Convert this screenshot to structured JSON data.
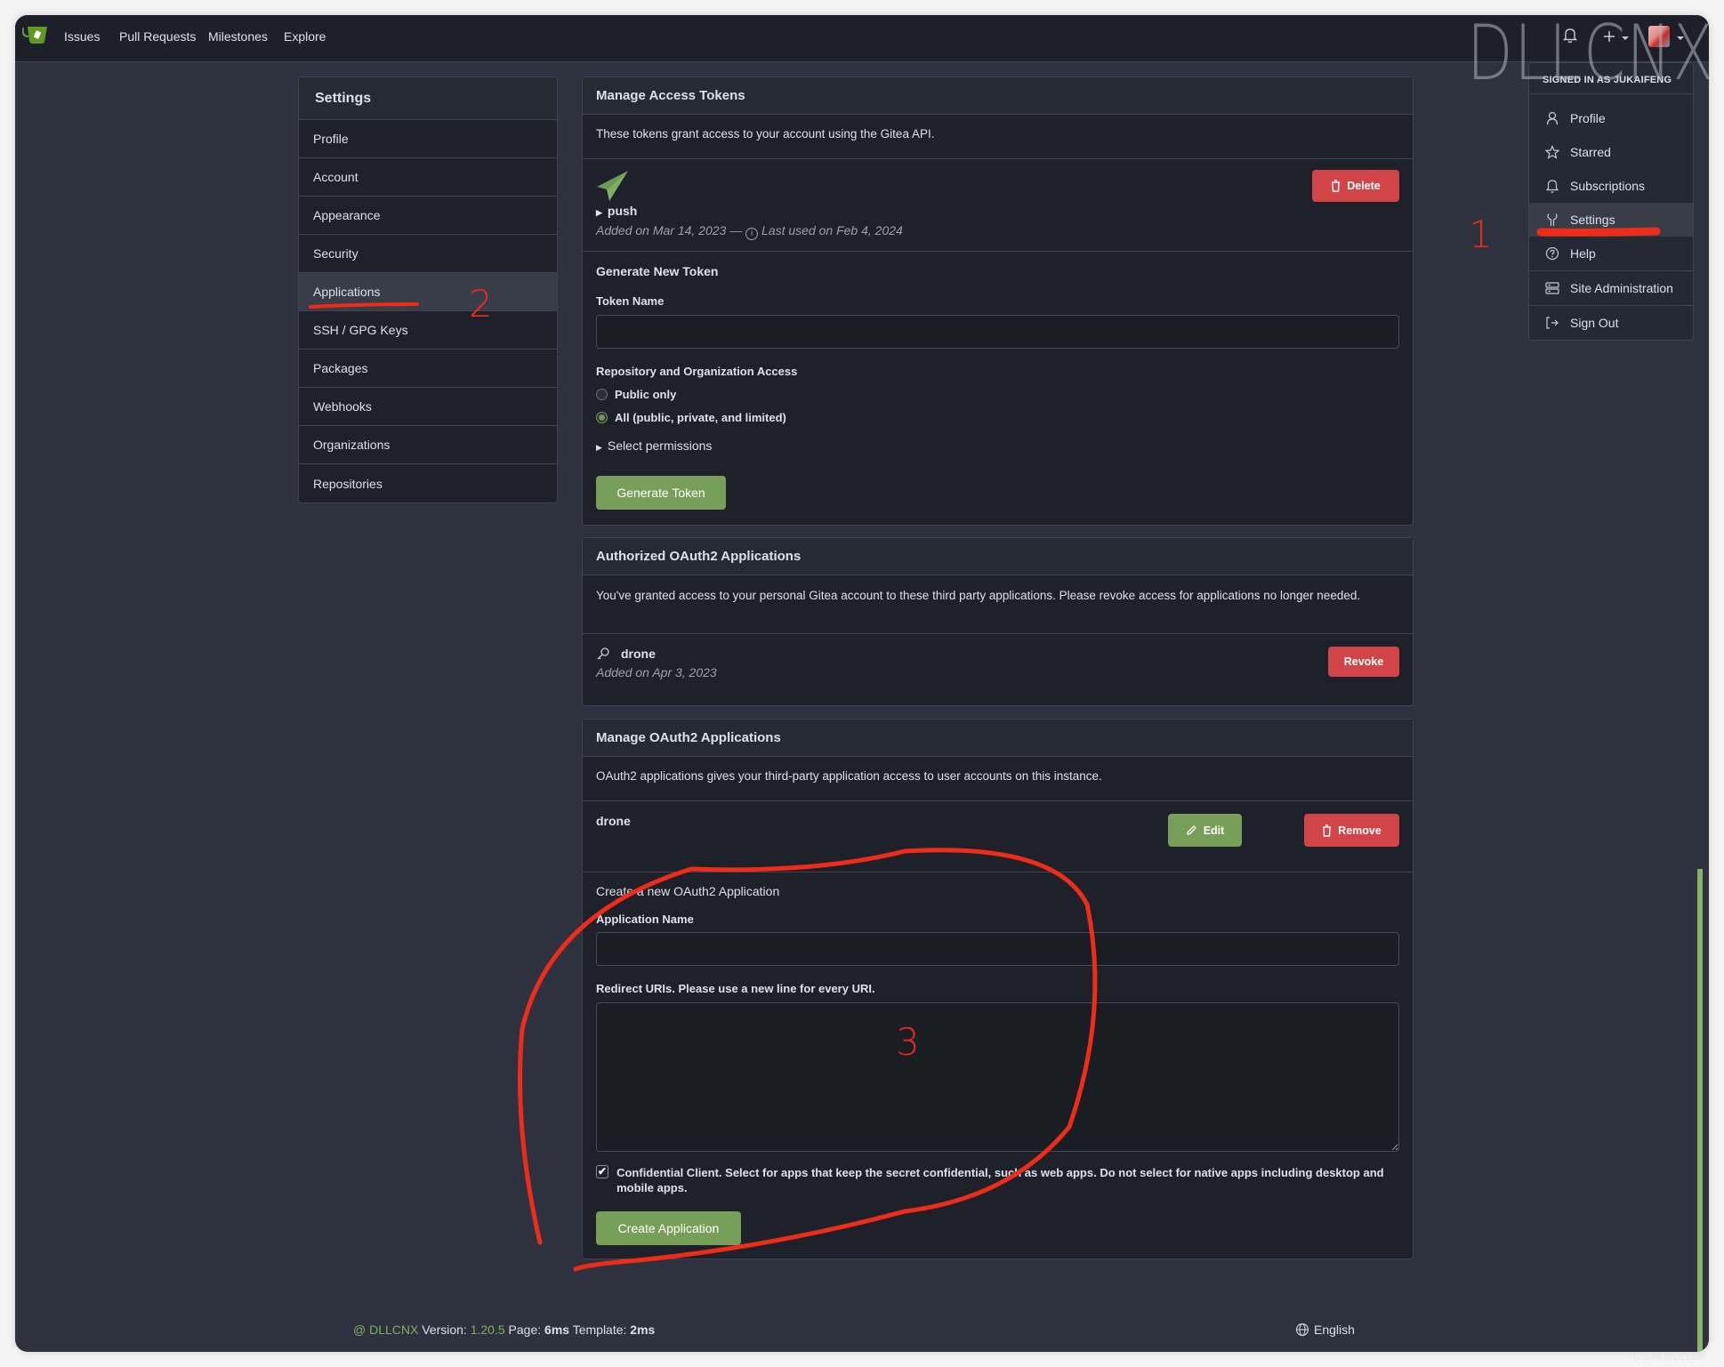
{
  "navbar": {
    "logo": "gitea-logo",
    "items": [
      "Issues",
      "Pull Requests",
      "Milestones",
      "Explore"
    ],
    "watermark": "DLLCNX",
    "icons": [
      "bell-icon",
      "plus-icon",
      "avatar"
    ]
  },
  "user_menu": {
    "signed_in": "SIGNED IN AS JUKAIFENG",
    "items": [
      {
        "label": "Profile",
        "icon": "person-icon"
      },
      {
        "label": "Starred",
        "icon": "star-icon"
      },
      {
        "label": "Subscriptions",
        "icon": "bell-icon"
      },
      {
        "label": "Settings",
        "icon": "tools-icon",
        "active": true
      },
      {
        "label": "Help",
        "icon": "question-icon"
      },
      {
        "label": "Site Administration",
        "icon": "server-icon"
      },
      {
        "label": "Sign Out",
        "icon": "sign-out-icon"
      }
    ]
  },
  "sidebar": {
    "title": "Settings",
    "items": [
      "Profile",
      "Account",
      "Appearance",
      "Security",
      "Applications",
      "SSH / GPG Keys",
      "Packages",
      "Webhooks",
      "Organizations",
      "Repositories"
    ],
    "active": "Applications"
  },
  "access_tokens": {
    "title": "Manage Access Tokens",
    "description": "These tokens grant access to your account using the Gitea API.",
    "token": {
      "name": "push",
      "added": "Added on Mar 14, 2023 —",
      "last_used": "Last used on Feb 4, 2024",
      "delete_label": "Delete"
    },
    "generate": {
      "title": "Generate New Token",
      "token_name_label": "Token Name",
      "token_name_value": "",
      "access_label": "Repository and Organization Access",
      "options": [
        "Public only",
        "All (public, private, and limited)"
      ],
      "selected_option": "All (public, private, and limited)",
      "permissions_label": "Select permissions",
      "button": "Generate Token"
    }
  },
  "authorized_apps": {
    "title": "Authorized OAuth2 Applications",
    "description": "You've granted access to your personal Gitea account to these third party applications. Please revoke access for applications no longer needed.",
    "app": {
      "name": "drone",
      "added": "Added on Apr 3, 2023",
      "revoke_label": "Revoke"
    }
  },
  "manage_apps": {
    "title": "Manage OAuth2 Applications",
    "description": "OAuth2 applications gives your third-party application access to user accounts on this instance.",
    "app": {
      "name": "drone",
      "edit_label": "Edit",
      "remove_label": "Remove"
    },
    "create": {
      "title": "Create a new OAuth2 Application",
      "name_label": "Application Name",
      "name_value": "",
      "redirect_label": "Redirect URIs. Please use a new line for every URI.",
      "redirect_value": "",
      "confidential_label": "Confidential Client. Select for apps that keep the secret confidential, such as web apps. Do not select for native apps including desktop and mobile apps.",
      "confidential_checked": true,
      "button": "Create Application"
    }
  },
  "footer": {
    "brand": "@ DLLCNX",
    "version_label": "Version:",
    "version": "1.20.5",
    "page_label": "Page:",
    "page_time": "6ms",
    "template_label": "Template:",
    "template_time": "2ms",
    "language": "English"
  },
  "annotations": {
    "step1": "1",
    "step2": "2",
    "step3": "3",
    "color": "#ee2c1a"
  },
  "colors": {
    "accent_green": "#789f5a",
    "danger_red": "#d14548",
    "background": "#2e323e"
  },
  "corner_watermark": "CSDN @DLLCN"
}
